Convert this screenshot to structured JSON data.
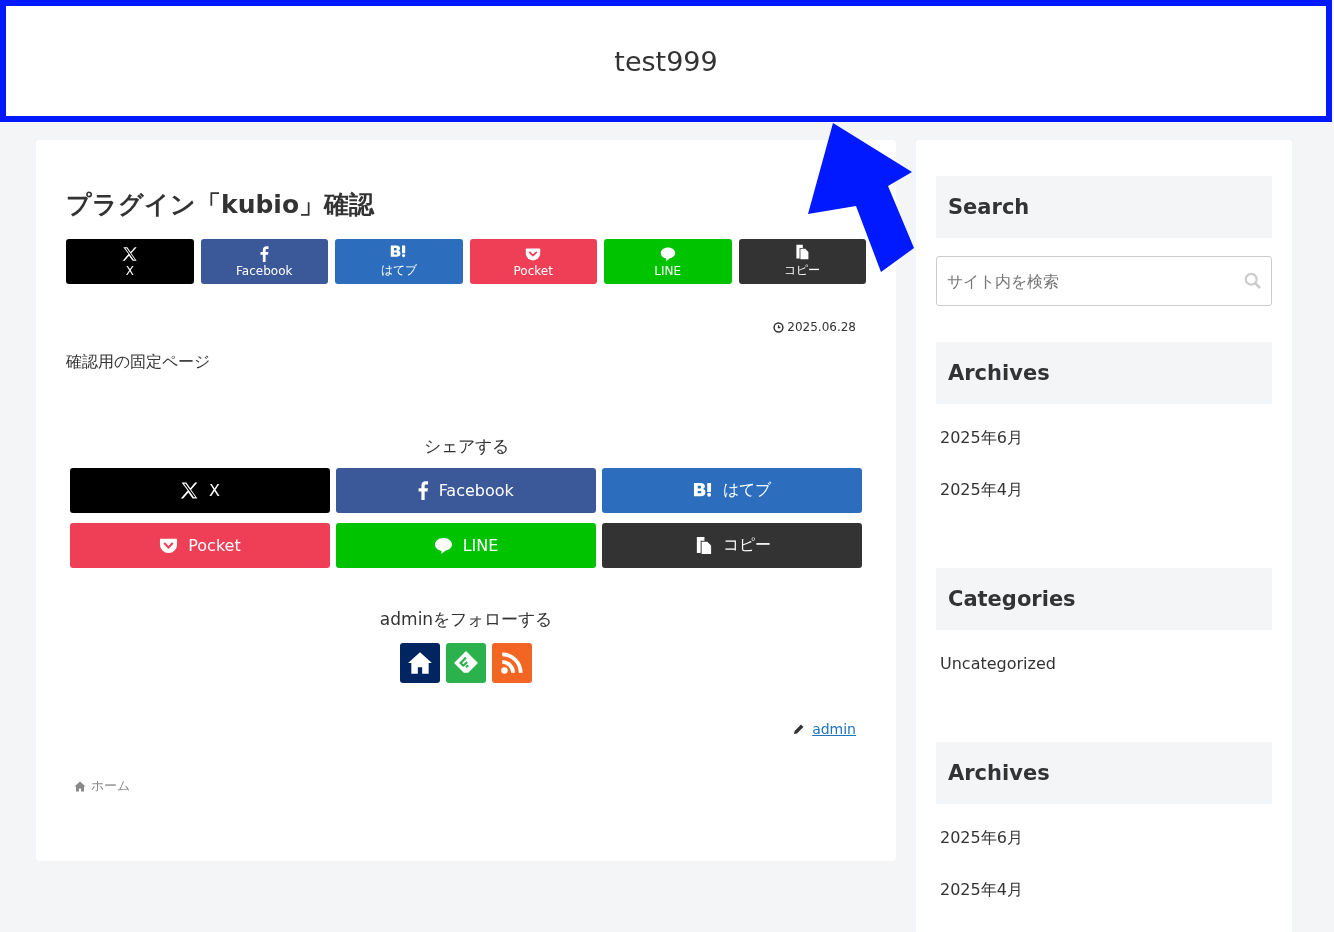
{
  "header": {
    "site_title": "test999"
  },
  "article": {
    "title": "プラグイン「kubio」確認",
    "top_share": [
      {
        "kind": "x",
        "label": "X"
      },
      {
        "kind": "facebook",
        "label": "Facebook"
      },
      {
        "kind": "hatena",
        "label": "はてブ"
      },
      {
        "kind": "pocket",
        "label": "Pocket"
      },
      {
        "kind": "line",
        "label": "LINE"
      },
      {
        "kind": "copy",
        "label": "コピー"
      }
    ],
    "date": "2025.06.28",
    "body": "確認用の固定ページ",
    "share_heading": "シェアする",
    "bottom_share": [
      {
        "kind": "x",
        "label": "X"
      },
      {
        "kind": "facebook",
        "label": "Facebook"
      },
      {
        "kind": "hatena",
        "label": "はてブ"
      },
      {
        "kind": "pocket",
        "label": "Pocket"
      },
      {
        "kind": "line",
        "label": "LINE"
      },
      {
        "kind": "copy",
        "label": "コピー"
      }
    ],
    "follow_heading": "adminをフォローする",
    "follow_buttons": [
      {
        "kind": "home"
      },
      {
        "kind": "feedly"
      },
      {
        "kind": "rss"
      }
    ],
    "author": "admin",
    "breadcrumb": "ホーム"
  },
  "sidebar": {
    "widgets": [
      {
        "kind": "search",
        "title": "Search",
        "placeholder": "サイト内を検索"
      },
      {
        "kind": "list",
        "title": "Archives",
        "items": [
          "2025年6月",
          "2025年4月"
        ]
      },
      {
        "kind": "list",
        "title": "Categories",
        "items": [
          "Uncategorized"
        ]
      },
      {
        "kind": "list",
        "title": "Archives",
        "items": [
          "2025年6月",
          "2025年4月"
        ]
      }
    ]
  }
}
